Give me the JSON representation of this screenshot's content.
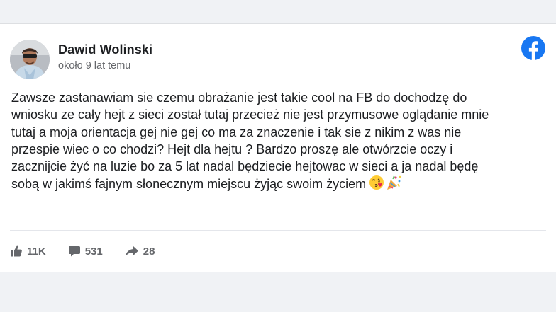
{
  "post": {
    "author": "Dawid Wolinski",
    "timestamp": "około 9 lat temu",
    "text": "Zawsze zastanawiam sie czemu obrażanie jest takie cool na FB do dochodzę do\nwniosku ze cały hejt z sieci został tutaj przecież nie jest przymusowe oglądanie mnie\ntutaj a moja orientacja gej nie gej co ma za znaczenie i tak sie z nikim z was nie\nprzespie wiec o co chodzi? Hejt dla hejtu ? Bardzo proszę ale otwórzcie oczy i\nzacznijcie żyć na luzie bo za 5 lat nadal będziecie hejtowac w sieci a ja nadal będę\nsobą w jakimś fajnym słonecznym miejscu żyjąc swoim życiem",
    "emojis": [
      "face-blowing-kiss-emoji",
      "party-popper-emoji"
    ]
  },
  "stats": {
    "likes": "11K",
    "comments": "531",
    "shares": "28"
  },
  "colors": {
    "page_background": "#f0f2f5",
    "card_background": "#ffffff",
    "facebook_blue": "#1877f2",
    "name_text": "#1c1e21",
    "secondary_text": "#65676b"
  },
  "icons": {
    "brand": "facebook-logo-icon",
    "like": "thumbs-up-icon",
    "comment": "comment-bubble-icon",
    "share": "share-arrow-icon"
  }
}
